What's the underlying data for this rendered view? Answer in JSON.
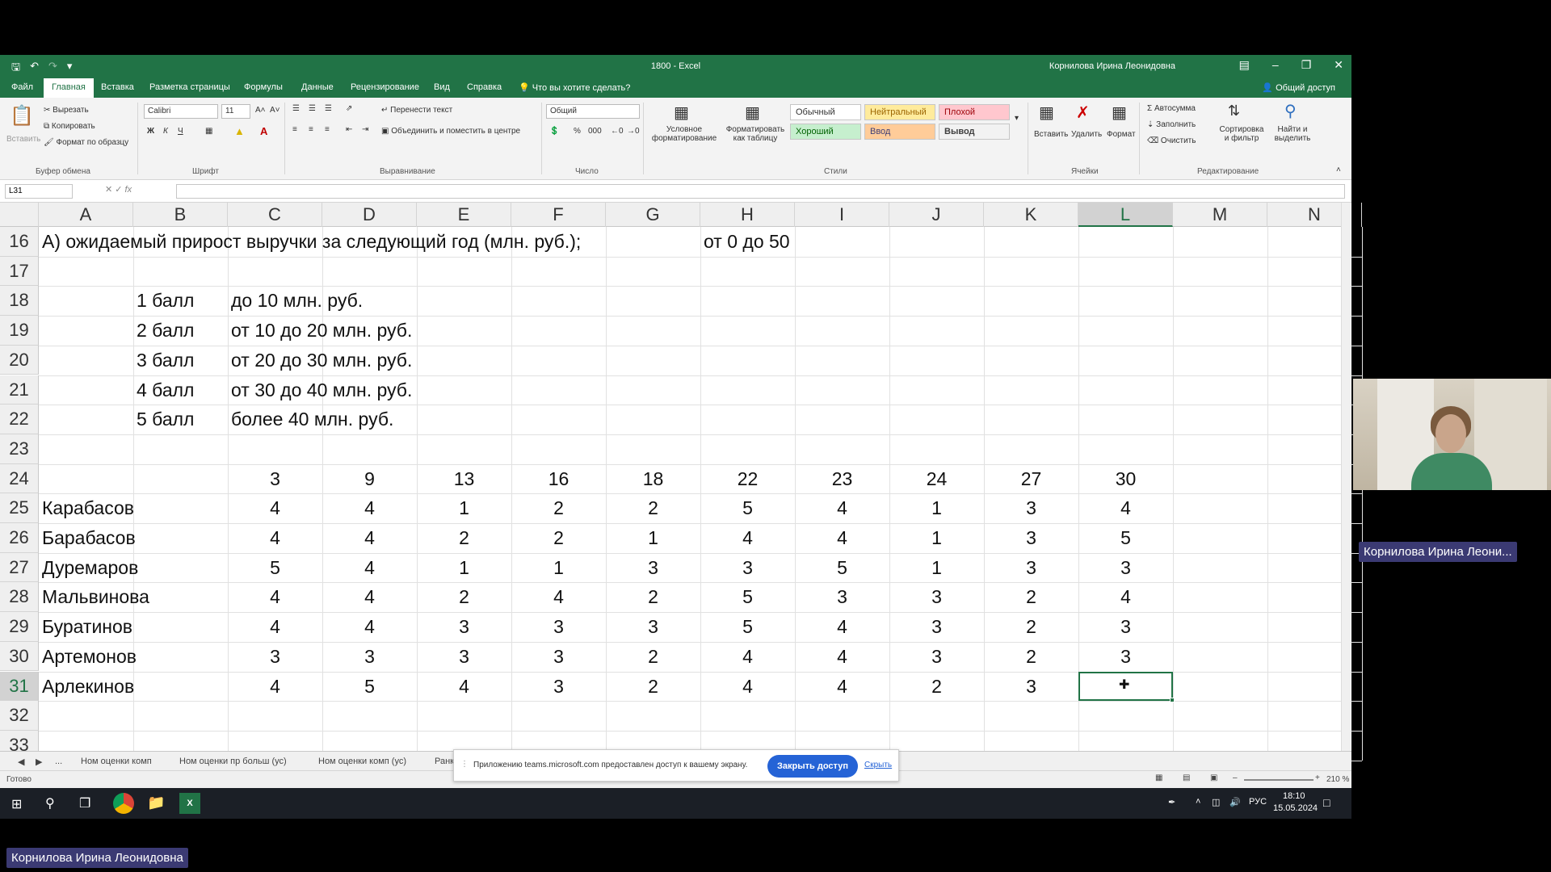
{
  "window": {
    "title": "1800  -  Excel",
    "user": "Корнилова Ирина Леонидовна"
  },
  "tabs": [
    "Файл",
    "Главная",
    "Вставка",
    "Разметка страницы",
    "Формулы",
    "Данные",
    "Рецензирование",
    "Вид",
    "Справка"
  ],
  "tell_me": "Что вы хотите сделать?",
  "share": "Общий доступ",
  "ribbon": {
    "clipboard": {
      "paste": "Вставить",
      "cut": "Вырезать",
      "copy": "Копировать",
      "format_painter": "Формат по образцу",
      "label": "Буфер обмена"
    },
    "font": {
      "name": "Calibri",
      "size": "11",
      "label": "Шрифт",
      "bold": "Ж",
      "italic": "К",
      "underline": "Ч"
    },
    "alignment": {
      "wrap": "Перенести текст",
      "merge": "Объединить и поместить в центре",
      "label": "Выравнивание"
    },
    "number": {
      "format": "Общий",
      "label": "Число"
    },
    "styles": {
      "conditional": "Условное форматирование",
      "as_table": "Форматировать как таблицу",
      "normal": "Обычный",
      "neutral": "Нейтральный",
      "bad": "Плохой",
      "good": "Хороший",
      "input": "Ввод",
      "output": "Вывод",
      "label": "Стили"
    },
    "cells": {
      "insert": "Вставить",
      "delete": "Удалить",
      "format": "Формат",
      "label": "Ячейки"
    },
    "editing": {
      "autosum": "Автосумма",
      "fill": "Заполнить",
      "clear": "Очистить",
      "sort": "Сортировка и фильтр",
      "find": "Найти и выделить",
      "label": "Редактирование"
    }
  },
  "name_box": "L31",
  "fx": "fx",
  "columns": [
    "A",
    "B",
    "C",
    "D",
    "E",
    "F",
    "G",
    "H",
    "I",
    "J",
    "K",
    "L",
    "M",
    "N"
  ],
  "selected_column": "L",
  "selected_row": "31",
  "rows": [
    {
      "n": "16",
      "a": "А) ожидаемый прирост выручки за следующий год (млн. руб.);",
      "h": "от 0 до 50"
    },
    {
      "n": "17"
    },
    {
      "n": "18",
      "b": "1 балл",
      "c": "до 10 млн. руб."
    },
    {
      "n": "19",
      "b": "2 балл",
      "c": "от 10 до 20 млн. руб."
    },
    {
      "n": "20",
      "b": "3 балл",
      "c": "от 20 до 30 млн. руб."
    },
    {
      "n": "21",
      "b": "4 балл",
      "c": "от 30 до 40 млн. руб."
    },
    {
      "n": "22",
      "b": "5 балл",
      "c": "более 40 млн. руб."
    },
    {
      "n": "23"
    },
    {
      "n": "24",
      "vals": [
        "3",
        "9",
        "13",
        "16",
        "18",
        "22",
        "23",
        "24",
        "27",
        "30"
      ]
    },
    {
      "n": "25",
      "a": "Карабасов",
      "vals": [
        "4",
        "4",
        "1",
        "2",
        "2",
        "5",
        "4",
        "1",
        "3",
        "4"
      ]
    },
    {
      "n": "26",
      "a": "Барабасов",
      "vals": [
        "4",
        "4",
        "2",
        "2",
        "1",
        "4",
        "4",
        "1",
        "3",
        "5"
      ]
    },
    {
      "n": "27",
      "a": "Дуремаров",
      "vals": [
        "5",
        "4",
        "1",
        "1",
        "3",
        "3",
        "5",
        "1",
        "3",
        "3"
      ]
    },
    {
      "n": "28",
      "a": "Мальвинова",
      "vals": [
        "4",
        "4",
        "2",
        "4",
        "2",
        "5",
        "3",
        "3",
        "2",
        "4"
      ]
    },
    {
      "n": "29",
      "a": "Буратинов",
      "vals": [
        "4",
        "4",
        "3",
        "3",
        "3",
        "5",
        "4",
        "3",
        "2",
        "3"
      ]
    },
    {
      "n": "30",
      "a": "Артемонов",
      "vals": [
        "3",
        "3",
        "3",
        "3",
        "2",
        "4",
        "4",
        "3",
        "2",
        "3"
      ]
    },
    {
      "n": "31",
      "a": "Арлекинов",
      "vals": [
        "4",
        "5",
        "4",
        "3",
        "2",
        "4",
        "4",
        "2",
        "3",
        ""
      ]
    },
    {
      "n": "32"
    },
    {
      "n": "33"
    }
  ],
  "sheets": [
    "...",
    "Ном оценки комп",
    "Ном оценки пр больш (ус)",
    "Ном оценки комп (ус)",
    "Ранк"
  ],
  "status": {
    "ready": "Готово",
    "zoom": "210 %"
  },
  "notification": {
    "message": "Приложению teams.microsoft.com предоставлен доступ к вашему экрану.",
    "stop": "Закрыть доступ",
    "hide": "Скрыть"
  },
  "taskbar": {
    "lang": "РУС",
    "time": "18:10",
    "date": "15.05.2024"
  },
  "participant_label": "Корнилова Ирина Леони...",
  "presenter_label": "Корнилова Ирина Леонидовна",
  "colors": {
    "excel_green": "#217346",
    "teams_blue": "#2563d6",
    "name_tag": "#3b3a73"
  }
}
